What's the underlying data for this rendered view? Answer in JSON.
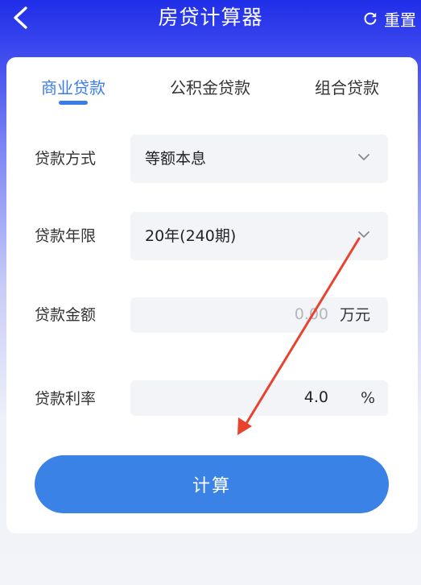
{
  "header": {
    "title": "房贷计算器",
    "reset_label": "重置"
  },
  "tabs": [
    {
      "label": "商业贷款",
      "active": true
    },
    {
      "label": "公积金贷款",
      "active": false
    },
    {
      "label": "组合贷款",
      "active": false
    }
  ],
  "form": {
    "method": {
      "label": "贷款方式",
      "value": "等额本息"
    },
    "term": {
      "label": "贷款年限",
      "value": "20年(240期)"
    },
    "amount": {
      "label": "贷款金额",
      "placeholder": "0.00",
      "unit": "万元"
    },
    "rate": {
      "label": "贷款利率",
      "value": "4.0",
      "unit": "%"
    }
  },
  "calculate_label": "计算",
  "colors": {
    "accent": "#3a7bea",
    "button": "#3a82e6",
    "annotation_arrow": "#e8432f"
  }
}
